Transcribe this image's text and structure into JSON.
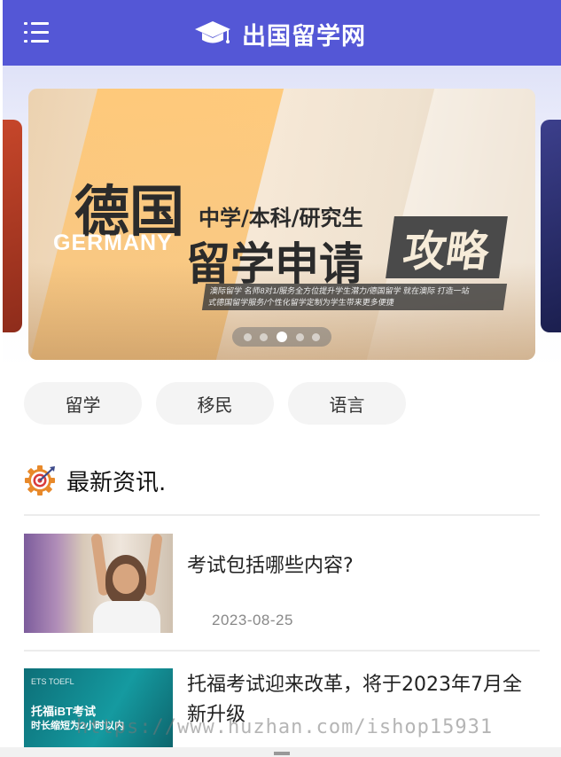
{
  "header": {
    "menu_icon": "menu-icon",
    "logo_icon": "graduation-cap-icon",
    "title": "出国留学网",
    "bg_color": "#5457d6"
  },
  "banner": {
    "title_de": "德国",
    "title_germany": "GERMANY",
    "levels": "中学/本科/研究生",
    "apply": "留学申请",
    "guide": "攻略",
    "desc_line1": "澳际留学 名师8对1/服务全方位提升学生潜力/德国留学 就在澳际 打造一站",
    "desc_line2": "式德国留学服务/个性化留学定制为学生带来更多便捷",
    "dot_count": 5,
    "active_dot": 3
  },
  "categories": [
    {
      "label": "留学"
    },
    {
      "label": "移民"
    },
    {
      "label": "语言"
    }
  ],
  "section": {
    "icon": "gear-target-icon",
    "title": "最新资讯."
  },
  "news": [
    {
      "title": "考试包括哪些内容?",
      "date": "2023-08-25"
    },
    {
      "title": "托福考试迎来改革，将于2023年7月全新升级",
      "img_text_small": "ETS TOEFL",
      "img_text_1": "托福iBT考试",
      "img_text_2": "时长缩短为2小时以内"
    }
  ],
  "watermark": "https://www.huzhan.com/ishop15931"
}
